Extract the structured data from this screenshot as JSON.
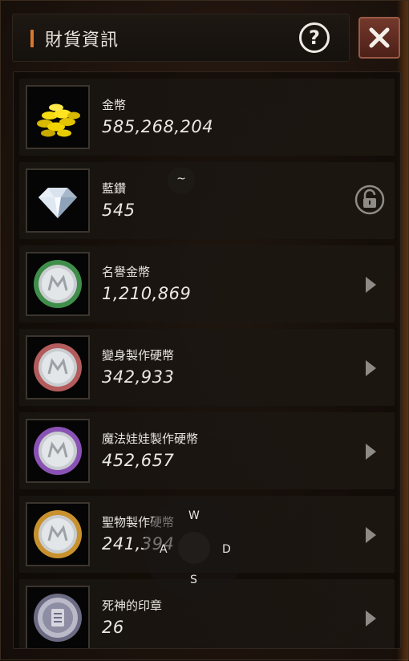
{
  "window": {
    "title": "財貨資訊"
  },
  "help_icon": "question-circle-icon",
  "close_icon": "close-x-icon",
  "currencies": [
    {
      "name": "金幣",
      "value": "585,268,204",
      "icon": "gold-coins-icon",
      "action": "none"
    },
    {
      "name": "藍鑽",
      "value": "545",
      "icon": "blue-diamond-icon",
      "action": "lock"
    },
    {
      "name": "名譽金幣",
      "value": "1,210,869",
      "icon": "honor-coin-icon",
      "action": "arrow",
      "color": "#4fae5a"
    },
    {
      "name": "變身製作硬幣",
      "value": "342,933",
      "icon": "transform-coin-icon",
      "action": "arrow",
      "color": "#c9686a"
    },
    {
      "name": "魔法娃娃製作硬幣",
      "value": "452,657",
      "icon": "doll-coin-icon",
      "action": "arrow",
      "color": "#9a5cc4"
    },
    {
      "name": "聖物製作硬幣",
      "value": "241,394",
      "icon": "relic-coin-icon",
      "action": "arrow",
      "color": "#d4a040"
    },
    {
      "name": "死神的印章",
      "value": "26",
      "icon": "reaper-seal-icon",
      "action": "arrow",
      "color": "#8a8aa6"
    }
  ],
  "overlay": {
    "tilde_key": "~",
    "keys": {
      "w": "W",
      "a": "A",
      "s": "S",
      "d": "D"
    }
  },
  "colors": {
    "accent": "#d9772b",
    "close_bg": "#6a3026"
  }
}
